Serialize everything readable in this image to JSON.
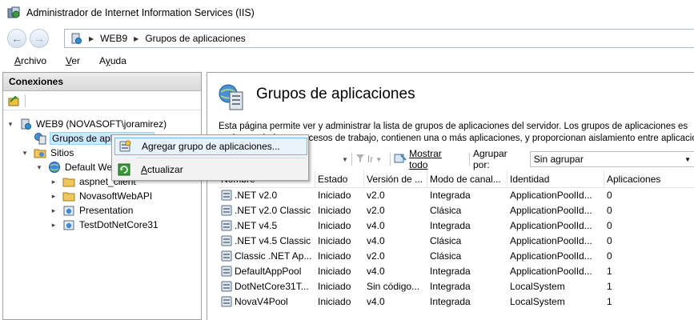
{
  "window": {
    "title": "Administrador de Internet Information Services (IIS)"
  },
  "address": {
    "crumbs": [
      "WEB9",
      "Grupos de aplicaciones"
    ]
  },
  "menu": [
    {
      "label": "Archivo",
      "accel": "A",
      "rest": "rchivo"
    },
    {
      "label": "Ver",
      "accel": "V",
      "rest": "er"
    },
    {
      "label": "Ayuda",
      "accel": "y",
      "pre": "A",
      "rest": "uda"
    }
  ],
  "connections": {
    "header": "Conexiones",
    "tree": [
      {
        "label": "WEB9 (NOVASOFT\\joramirez)",
        "level": 0,
        "expander": "down",
        "icon": "server-icon"
      },
      {
        "label": "Grupos de aplicaciones",
        "level": 1,
        "expander": "",
        "icon": "app-pool-icon",
        "selected": true
      },
      {
        "label": "Sitios",
        "level": 1,
        "expander": "down",
        "icon": "sites-folder-icon"
      },
      {
        "label": "Default Web Site",
        "level": 2,
        "expander": "down",
        "icon": "globe-icon"
      },
      {
        "label": "aspnet_client",
        "level": 3,
        "expander": "right",
        "icon": "folder-icon"
      },
      {
        "label": "NovasoftWebAPI",
        "level": 3,
        "expander": "right",
        "icon": "folder-icon"
      },
      {
        "label": "Presentation",
        "level": 3,
        "expander": "right",
        "icon": "web-app-icon"
      },
      {
        "label": "TestDotNetCore31",
        "level": 3,
        "expander": "right",
        "icon": "web-app-icon"
      }
    ]
  },
  "context_menu": {
    "items": [
      {
        "label": "Agregar grupo de aplicaciones...",
        "accel": "A",
        "icon": "add-pool-icon",
        "highlighted": true
      },
      {
        "label": "Actualizar",
        "accel": "A",
        "icon": "refresh-icon",
        "highlighted": false
      }
    ]
  },
  "main": {
    "title": "Grupos de aplicaciones",
    "description_line1": "Esta página permite ver y administrar la lista de grupos de aplicaciones del servidor. Los grupos de aplicaciones es",
    "description_line2": "están asociados a procesos de trabajo, contienen una o más aplicaciones, y proporcionan aislamiento entre aplicaciones.",
    "filter": {
      "go_label": "Ir",
      "show_all_label": "Mostrar todo",
      "group_by_label": "Agrupar por:",
      "group_by_value": "Sin agrupar"
    },
    "columns": [
      "Nombre",
      "Estado",
      "Versión de ...",
      "Modo de canal...",
      "Identidad",
      "Aplicaciones"
    ],
    "rows": [
      [
        ".NET v2.0",
        "Iniciado",
        "v2.0",
        "Integrada",
        "ApplicationPoolId...",
        "0"
      ],
      [
        ".NET v2.0 Classic",
        "Iniciado",
        "v2.0",
        "Clásica",
        "ApplicationPoolId...",
        "0"
      ],
      [
        ".NET v4.5",
        "Iniciado",
        "v4.0",
        "Integrada",
        "ApplicationPoolId...",
        "0"
      ],
      [
        ".NET v4.5 Classic",
        "Iniciado",
        "v4.0",
        "Clásica",
        "ApplicationPoolId...",
        "0"
      ],
      [
        "Classic .NET Ap...",
        "Iniciado",
        "v2.0",
        "Clásica",
        "ApplicationPoolId...",
        "0"
      ],
      [
        "DefaultAppPool",
        "Iniciado",
        "v4.0",
        "Integrada",
        "ApplicationPoolId...",
        "1"
      ],
      [
        "DotNetCore31T...",
        "Iniciado",
        "Sin código...",
        "Integrada",
        "LocalSystem",
        "1"
      ],
      [
        "NovaV4Pool",
        "Iniciado",
        "v4.0",
        "Integrada",
        "LocalSystem",
        "1"
      ]
    ]
  }
}
